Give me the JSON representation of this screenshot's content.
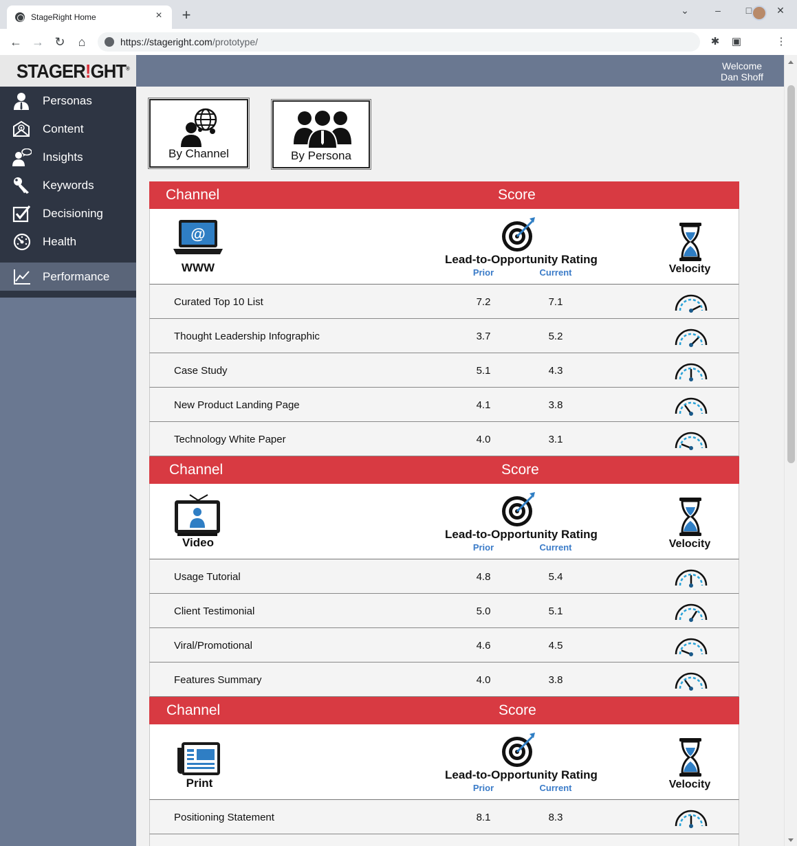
{
  "browser": {
    "tab_title": "StageRight Home",
    "url_host": "https://stageright.com",
    "url_path": "/prototype/"
  },
  "app": {
    "logo_prefix": "STAGER",
    "logo_i": "!",
    "logo_suffix": "GHT",
    "logo_reg": "®",
    "welcome_line1": "Welcome",
    "welcome_line2": "Dan Shoff"
  },
  "sidebar": {
    "items": [
      {
        "label": "Personas",
        "icon": "person-icon"
      },
      {
        "label": "Content",
        "icon": "envelope-at-icon"
      },
      {
        "label": "Insights",
        "icon": "speech-person-icon"
      },
      {
        "label": "Keywords",
        "icon": "key-icon"
      },
      {
        "label": "Decisioning",
        "icon": "checkbox-icon"
      },
      {
        "label": "Health",
        "icon": "dashboard-icon"
      },
      {
        "label": "Performance",
        "icon": "chart-line-icon",
        "active": true
      }
    ]
  },
  "views": {
    "by_channel": "By Channel",
    "by_persona": "By Persona"
  },
  "table": {
    "head_channel": "Channel",
    "head_score": "Score",
    "rating_label": "Lead-to-Opportunity Rating",
    "prior_label": "Prior",
    "current_label": "Current",
    "velocity_label": "Velocity",
    "sections": [
      {
        "channel": "WWW",
        "icon": "laptop-at-icon",
        "rows": [
          {
            "name": "Curated Top 10 List",
            "prior": "7.2",
            "current": "7.1",
            "velocity": 0.85
          },
          {
            "name": "Thought Leadership Infographic",
            "prior": "3.7",
            "current": "5.2",
            "velocity": 0.75
          },
          {
            "name": "Case Study",
            "prior": "5.1",
            "current": "4.3",
            "velocity": 0.5
          },
          {
            "name": "New Product Landing Page",
            "prior": "4.1",
            "current": "3.8",
            "velocity": 0.3
          },
          {
            "name": "Technology White Paper",
            "prior": "4.0",
            "current": "3.1",
            "velocity": 0.12
          }
        ]
      },
      {
        "channel": "Video",
        "icon": "tv-person-icon",
        "rows": [
          {
            "name": "Usage Tutorial",
            "prior": "4.8",
            "current": "5.4",
            "velocity": 0.5
          },
          {
            "name": "Client Testimonial",
            "prior": "5.0",
            "current": "5.1",
            "velocity": 0.68
          },
          {
            "name": "Viral/Promotional",
            "prior": "4.6",
            "current": "4.5",
            "velocity": 0.12
          },
          {
            "name": "Features Summary",
            "prior": "4.0",
            "current": "3.8",
            "velocity": 0.3
          }
        ]
      },
      {
        "channel": "Print",
        "icon": "newspaper-icon",
        "rows": [
          {
            "name": "Positioning Statement",
            "prior": "8.1",
            "current": "8.3",
            "velocity": 0.5
          }
        ]
      }
    ]
  },
  "colors": {
    "header_red": "#d83a42",
    "accent_blue": "#3a7bc8",
    "sidebar_dark": "#2e3543",
    "sidebar_slate": "#6a7891"
  }
}
